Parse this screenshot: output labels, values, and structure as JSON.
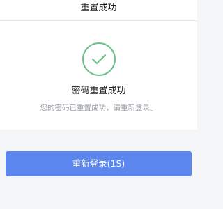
{
  "header": {
    "title": "重置成功"
  },
  "result": {
    "icon": "check-circle-icon",
    "title": "密码重置成功",
    "description": "您的密码已重置成功，请重新登录。"
  },
  "actions": {
    "relogin_label": "重新登录(1S)"
  },
  "colors": {
    "success": "#6cc08a",
    "primary": "#5b86ee",
    "background": "#f5f6f8"
  }
}
